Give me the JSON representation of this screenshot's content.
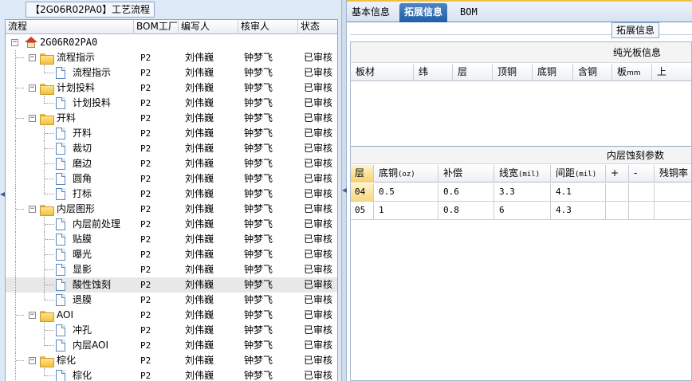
{
  "left_pane": {
    "title": "【2G06R02PA0】工艺流程",
    "tree_columns": [
      "流程",
      "BOM工厂",
      "编写人",
      "核审人",
      "状态"
    ],
    "root_name": "2G06R02PA0",
    "rows": [
      {
        "name": "流程指示",
        "kind": "folder",
        "factory": "P2",
        "author": "刘伟巍",
        "reviewer": "钟梦飞",
        "status": "已审核"
      },
      {
        "name": "流程指示",
        "kind": "doc",
        "factory": "P2",
        "author": "刘伟巍",
        "reviewer": "钟梦飞",
        "status": "已审核"
      },
      {
        "name": "计划投料",
        "kind": "folder",
        "factory": "P2",
        "author": "刘伟巍",
        "reviewer": "钟梦飞",
        "status": "已审核"
      },
      {
        "name": "计划投料",
        "kind": "doc",
        "factory": "P2",
        "author": "刘伟巍",
        "reviewer": "钟梦飞",
        "status": "已审核"
      },
      {
        "name": "开料",
        "kind": "folder",
        "factory": "P2",
        "author": "刘伟巍",
        "reviewer": "钟梦飞",
        "status": "已审核"
      },
      {
        "name": "开料",
        "kind": "doc",
        "factory": "P2",
        "author": "刘伟巍",
        "reviewer": "钟梦飞",
        "status": "已审核"
      },
      {
        "name": "裁切",
        "kind": "doc",
        "factory": "P2",
        "author": "刘伟巍",
        "reviewer": "钟梦飞",
        "status": "已审核"
      },
      {
        "name": "磨边",
        "kind": "doc",
        "factory": "P2",
        "author": "刘伟巍",
        "reviewer": "钟梦飞",
        "status": "已审核"
      },
      {
        "name": "圆角",
        "kind": "doc",
        "factory": "P2",
        "author": "刘伟巍",
        "reviewer": "钟梦飞",
        "status": "已审核"
      },
      {
        "name": "打标",
        "kind": "doc",
        "factory": "P2",
        "author": "刘伟巍",
        "reviewer": "钟梦飞",
        "status": "已审核"
      },
      {
        "name": "内层图形",
        "kind": "folder",
        "factory": "P2",
        "author": "刘伟巍",
        "reviewer": "钟梦飞",
        "status": "已审核"
      },
      {
        "name": "内层前处理",
        "kind": "doc",
        "factory": "P2",
        "author": "刘伟巍",
        "reviewer": "钟梦飞",
        "status": "已审核"
      },
      {
        "name": "贴膜",
        "kind": "doc",
        "factory": "P2",
        "author": "刘伟巍",
        "reviewer": "钟梦飞",
        "status": "已审核"
      },
      {
        "name": "曝光",
        "kind": "doc",
        "factory": "P2",
        "author": "刘伟巍",
        "reviewer": "钟梦飞",
        "status": "已审核"
      },
      {
        "name": "显影",
        "kind": "doc",
        "factory": "P2",
        "author": "刘伟巍",
        "reviewer": "钟梦飞",
        "status": "已审核"
      },
      {
        "name": "酸性蚀刻",
        "kind": "doc",
        "factory": "P2",
        "author": "刘伟巍",
        "reviewer": "钟梦飞",
        "status": "已审核",
        "selected": true
      },
      {
        "name": "退膜",
        "kind": "doc",
        "factory": "P2",
        "author": "刘伟巍",
        "reviewer": "钟梦飞",
        "status": "已审核"
      },
      {
        "name": "AOI",
        "kind": "folder",
        "factory": "P2",
        "author": "刘伟巍",
        "reviewer": "钟梦飞",
        "status": "已审核"
      },
      {
        "name": "冲孔",
        "kind": "doc",
        "factory": "P2",
        "author": "刘伟巍",
        "reviewer": "钟梦飞",
        "status": "已审核"
      },
      {
        "name": "内层AOI",
        "kind": "doc",
        "factory": "P2",
        "author": "刘伟巍",
        "reviewer": "钟梦飞",
        "status": "已审核"
      },
      {
        "name": "棕化",
        "kind": "folder",
        "factory": "P2",
        "author": "刘伟巍",
        "reviewer": "钟梦飞",
        "status": "已审核"
      },
      {
        "name": "棕化",
        "kind": "doc",
        "factory": "P2",
        "author": "刘伟巍",
        "reviewer": "钟梦飞",
        "status": "已审核"
      }
    ]
  },
  "right_pane": {
    "tabs": [
      {
        "label": "基本信息",
        "active": false
      },
      {
        "label": "拓展信息",
        "active": true
      },
      {
        "label": "BOM",
        "active": false
      }
    ],
    "ext_label": "拓展信息",
    "plate": {
      "title": "纯光板信息",
      "columns": [
        "板材",
        "纬",
        "层",
        "顶铜",
        "底铜",
        "含铜",
        "板",
        "mm",
        "上"
      ]
    },
    "inner": {
      "title": "内层蚀刻参数",
      "columns": [
        "层",
        "底铜",
        "(oz)",
        "补偿",
        "线宽",
        "(mil)",
        "间距",
        "(mil)",
        "+",
        "-",
        "残铜率"
      ],
      "rows": [
        {
          "layer": "04",
          "base_cu": "0.5",
          "comp": "0.6",
          "width": "3.3",
          "spacing": "4.1"
        },
        {
          "layer": "05",
          "base_cu": "1",
          "comp": "0.8",
          "width": "6",
          "spacing": "4.3"
        }
      ]
    }
  }
}
